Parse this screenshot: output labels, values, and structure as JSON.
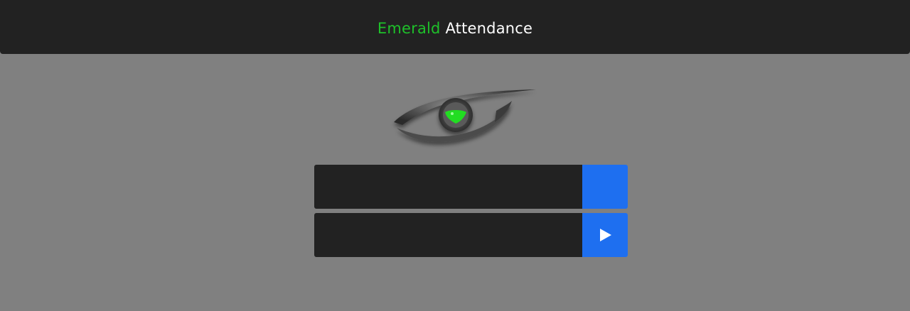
{
  "header": {
    "title_brand": "Emerald",
    "title_rest": "Attendance"
  },
  "logo": {
    "icon": "eye-logo",
    "iris_color": "#22dd22"
  },
  "form": {
    "field1": {
      "value": "",
      "placeholder": ""
    },
    "field2": {
      "value": "",
      "placeholder": ""
    },
    "submit_icon": "play-icon"
  },
  "colors": {
    "accent": "#1e6ff0",
    "brand": "#1ec12a",
    "panel": "#222222",
    "background": "#808080"
  }
}
